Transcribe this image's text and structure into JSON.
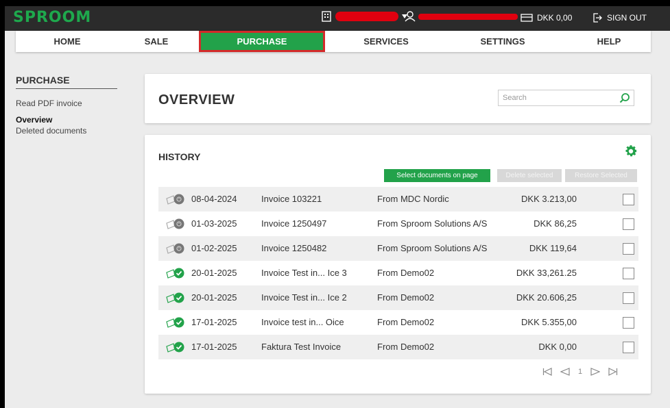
{
  "app": {
    "logo": "SPROOM"
  },
  "topbar": {
    "balance": "DKK 0,00",
    "signout": "SIGN OUT"
  },
  "nav": {
    "items": [
      {
        "label": "HOME"
      },
      {
        "label": "SALE"
      },
      {
        "label": "PURCHASE"
      },
      {
        "label": "SERVICES"
      },
      {
        "label": "SETTINGS"
      },
      {
        "label": "HELP"
      }
    ],
    "active": "PURCHASE"
  },
  "sidebar": {
    "title": "PURCHASE",
    "links": [
      {
        "label": "Read PDF invoice"
      },
      {
        "label": "Overview"
      },
      {
        "label": "Deleted documents"
      }
    ]
  },
  "overview": {
    "title": "OVERVIEW",
    "search_placeholder": "Search"
  },
  "history": {
    "title": "HISTORY",
    "buttons": {
      "select": "Select documents on page",
      "delete": "Delete selected",
      "restore": "Restore Selected"
    },
    "rows": [
      {
        "status": "pending",
        "date": "08-04-2024",
        "name": "Invoice 103221",
        "from": "From MDC Nordic",
        "amount": "DKK 3.213,00"
      },
      {
        "status": "pending",
        "date": "01-03-2025",
        "name": "Invoice 1250497",
        "from": "From Sproom Solutions A/S",
        "amount": "DKK 86,25"
      },
      {
        "status": "pending",
        "date": "01-02-2025",
        "name": "Invoice 1250482",
        "from": "From Sproom Solutions A/S",
        "amount": "DKK 119,64"
      },
      {
        "status": "done",
        "date": "20-01-2025",
        "name": "Invoice Test in... Ice 3",
        "from": "From Demo02",
        "amount": "DKK 33,261.25"
      },
      {
        "status": "done",
        "date": "20-01-2025",
        "name": "Invoice Test in... Ice 2",
        "from": "From Demo02",
        "amount": "DKK 20.606,25"
      },
      {
        "status": "done",
        "date": "17-01-2025",
        "name": "Invoice test in... Oice",
        "from": "From Demo02",
        "amount": "DKK 5.355,00"
      },
      {
        "status": "done",
        "date": "17-01-2025",
        "name": "Faktura Test Invoice",
        "from": "From Demo02",
        "amount": "DKK 0,00"
      }
    ],
    "pager": {
      "page": "1"
    }
  },
  "colors": {
    "brand_green": "#22a24a",
    "topbar": "#2b2b2b",
    "highlight_border": "#d42a2a",
    "redaction": "#e0000f"
  }
}
